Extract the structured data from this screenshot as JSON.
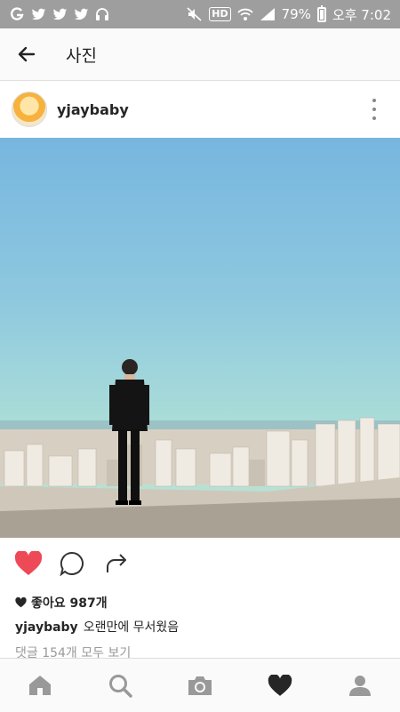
{
  "status_bar": {
    "battery": "79%",
    "time": "오후 7:02",
    "hd_label": "HD",
    "left_icons": [
      "g-icon",
      "twitter-icon",
      "twitter-icon",
      "twitter-icon",
      "headphones-icon"
    ],
    "battery_level": 0.79
  },
  "topbar": {
    "title": "사진"
  },
  "post": {
    "username": "yjaybaby",
    "likes_text": "좋아요 987개",
    "caption_user": "yjaybaby",
    "caption_text": "오랜만에 무서웠음",
    "comments_text": "댓글 154개 모두 보기"
  },
  "colors": {
    "like_red": "#ed4956",
    "status_bg": "#9e9e9e",
    "icon_gray": "#999999"
  },
  "bottom_nav": [
    "home-icon",
    "search-icon",
    "camera-icon",
    "heart-icon",
    "profile-icon"
  ]
}
